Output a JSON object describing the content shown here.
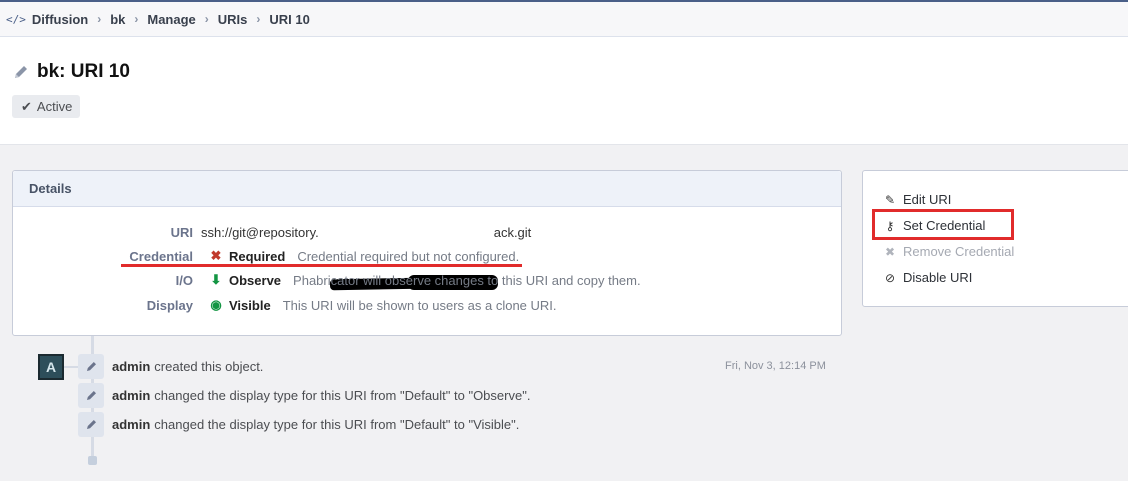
{
  "breadcrumbs": {
    "app_icon": "</>",
    "items": [
      "Diffusion",
      "bk",
      "Manage",
      "URIs",
      "URI 10"
    ]
  },
  "header": {
    "title": "bk: URI 10",
    "status": "Active"
  },
  "details": {
    "heading": "Details",
    "uri_label": "URI",
    "uri_prefix": "ssh://git@repository.",
    "uri_suffix": "ack.git",
    "credential_label": "Credential",
    "credential_value": "Required",
    "credential_desc": "Credential required but not configured.",
    "io_label": "I/O",
    "io_value": "Observe",
    "io_desc": "Phabricator will observe changes to this URI and copy them.",
    "display_label": "Display",
    "display_value": "Visible",
    "display_desc": "This URI will be shown to users as a clone URI."
  },
  "actions": {
    "edit": "Edit URI",
    "set_credential": "Set Credential",
    "remove_credential": "Remove Credential",
    "disable": "Disable URI"
  },
  "timeline": {
    "avatar_letter": "A",
    "date": "Fri, Nov 3, 12:14 PM",
    "events": [
      {
        "who": "admin",
        "text": "created this object."
      },
      {
        "who": "admin",
        "text": "changed the display type for this URI from \"Default\" to \"Observe\"."
      },
      {
        "who": "admin",
        "text": "changed the display type for this URI from \"Default\" to \"Visible\"."
      }
    ]
  },
  "colors": {
    "accent": "#4a5f88",
    "annotation_red": "#e12b2b",
    "required_red": "#c0392b",
    "observe_green": "#139543"
  }
}
